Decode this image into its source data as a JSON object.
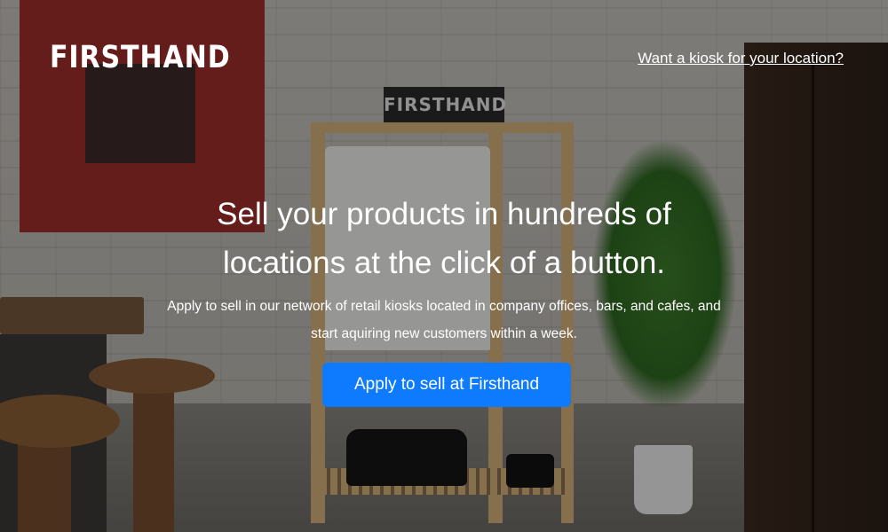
{
  "header": {
    "logo_text": "FIRSTHAND",
    "kiosk_link_label": "Want a kiosk for your location?"
  },
  "background": {
    "rack_sign_text": "FIRSTHAND"
  },
  "hero": {
    "headline_line1": "Sell your products in hundreds of",
    "headline_line2": "locations at the click of a button.",
    "subtext": "Apply to sell in our network of retail kiosks located in company offices, bars, and cafes, and start aquiring new customers within a week.",
    "cta_label": "Apply to sell at Firsthand"
  },
  "colors": {
    "cta_background": "#0e7bff",
    "text": "#ffffff"
  }
}
